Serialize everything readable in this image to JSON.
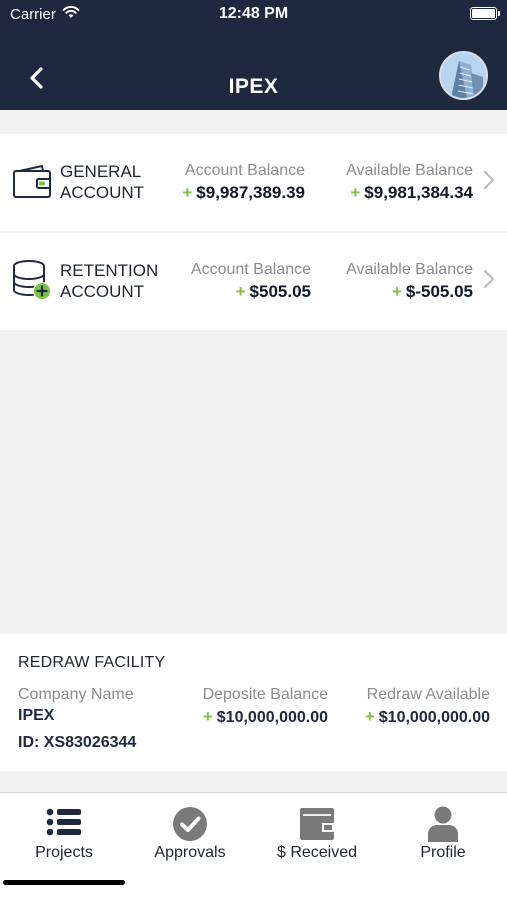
{
  "status_bar": {
    "carrier": "Carrier",
    "time": "12:48 PM"
  },
  "header": {
    "title": "IPEX"
  },
  "accounts": [
    {
      "name_line1": "GENERAL",
      "name_line2": "ACCOUNT",
      "account_balance_label": "Account Balance",
      "account_balance": "$9,987,389.39",
      "available_balance_label": "Available Balance",
      "available_balance": "$9,981,384.34",
      "icon": "wallet-icon"
    },
    {
      "name_line1": "RETENTION",
      "name_line2": "ACCOUNT",
      "account_balance_label": "Account Balance",
      "account_balance": "$505.05",
      "available_balance_label": "Available Balance",
      "available_balance": "$-505.05",
      "icon": "database-add-icon"
    }
  ],
  "redraw": {
    "heading": "REDRAW FACILITY",
    "company_label": "Company Name",
    "company_value": "IPEX",
    "id_value": "ID: XS83026344",
    "deposit_label": "Deposite Balance",
    "deposit_value": "$10,000,000.00",
    "redraw_label": "Redraw Available",
    "redraw_value": "$10,000,000.00"
  },
  "plus_sign": "+",
  "tabs": [
    {
      "label": "Projects",
      "icon": "list-icon"
    },
    {
      "label": "Approvals",
      "icon": "check-circle-icon"
    },
    {
      "label": "$ Received",
      "icon": "wallet-icon"
    },
    {
      "label": "Profile",
      "icon": "person-icon"
    }
  ],
  "colors": {
    "header_bg": "#1e2940",
    "accent_green": "#7dc242"
  }
}
